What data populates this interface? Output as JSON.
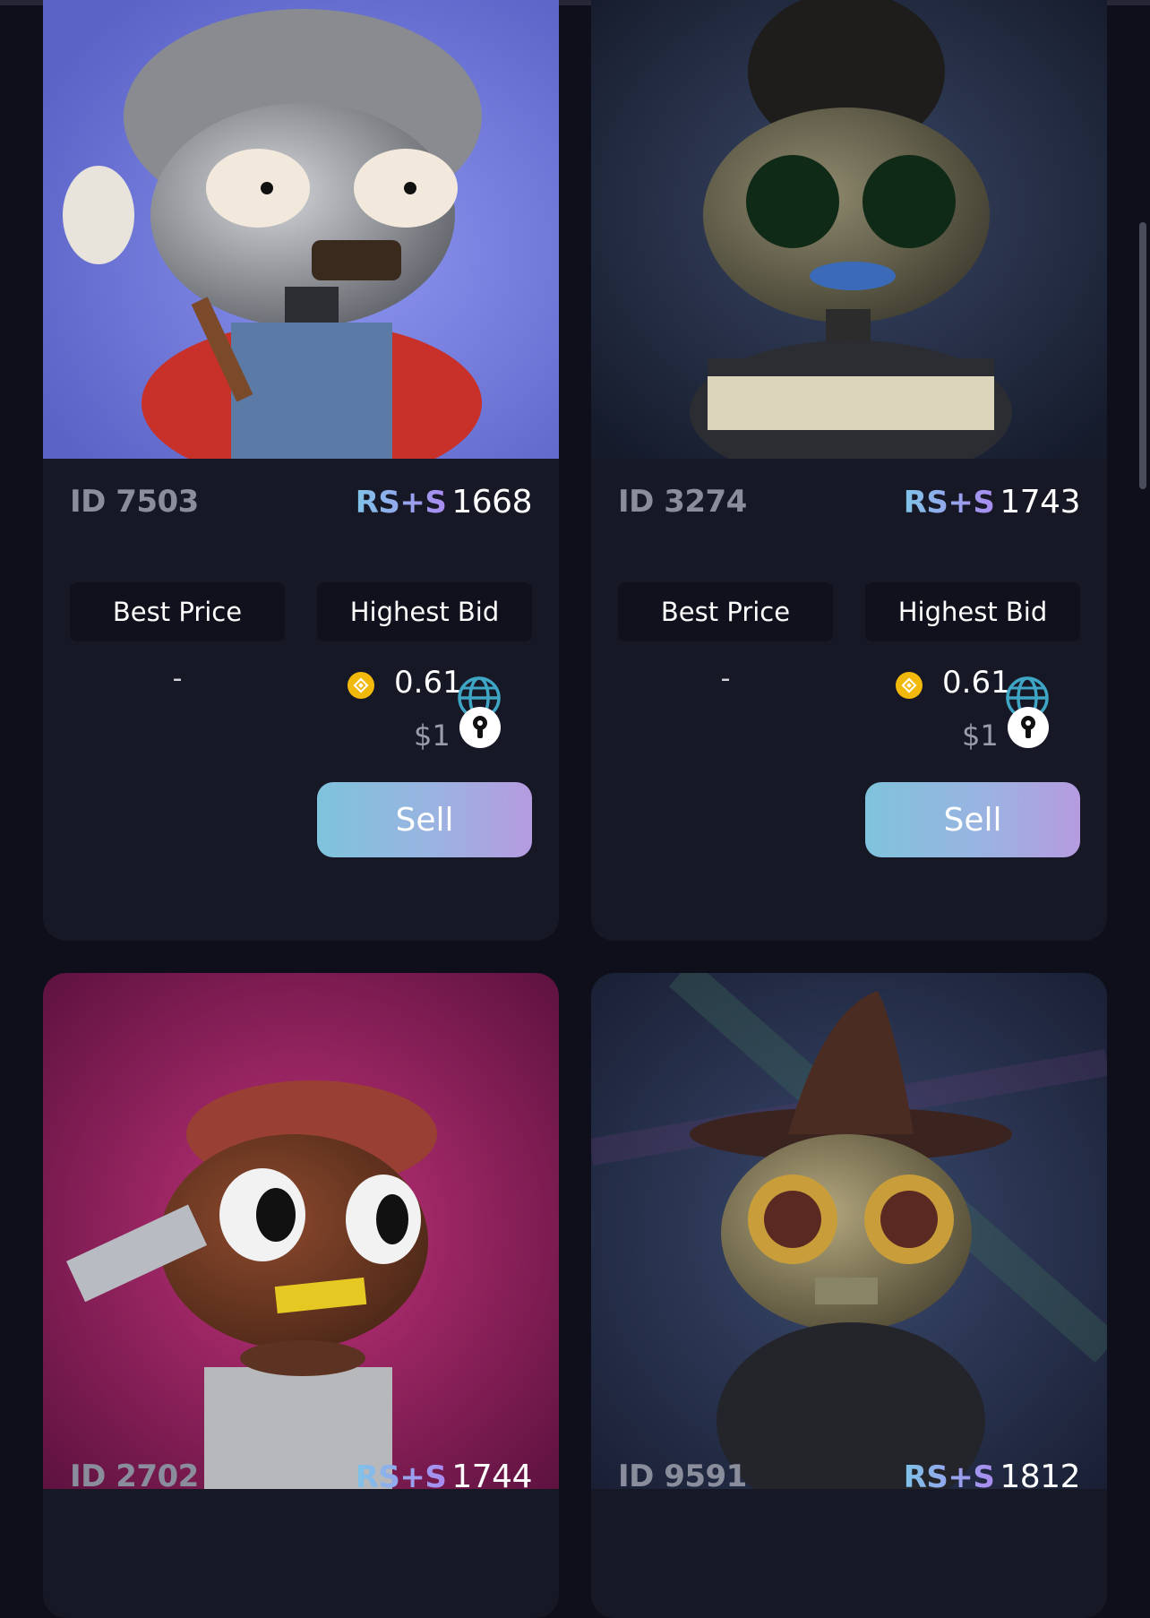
{
  "cards": [
    {
      "id_label": "ID 7503",
      "rs_label": "RS+S",
      "rs_value": "1668",
      "best_price_tab": "Best Price",
      "highest_bid_tab": "Highest Bid",
      "best_price_value": "-",
      "highest_bid_amount": "0.61",
      "highest_bid_usd": "$1",
      "sell_label": "Sell",
      "background": "#6a74d8"
    },
    {
      "id_label": "ID 3274",
      "rs_label": "RS+S",
      "rs_value": "1743",
      "best_price_tab": "Best Price",
      "highest_bid_tab": "Highest Bid",
      "best_price_value": "-",
      "highest_bid_amount": "0.61",
      "highest_bid_usd": "$1",
      "sell_label": "Sell",
      "background": "#2b3550"
    },
    {
      "id_label": "ID 2702",
      "rs_label": "RS+S",
      "rs_value": "1744",
      "background": "#a3205f"
    },
    {
      "id_label": "ID 9591",
      "rs_label": "RS+S",
      "rs_value": "1812",
      "background": "#27304a"
    }
  ],
  "colors": {
    "page_background": "#0e0f1a",
    "card_background": "#171826",
    "accent_gradient_start": "#7fc3dc",
    "accent_gradient_end": "#b69be0",
    "coin_color": "#f0b90b",
    "globe_color": "#3ea6c4"
  },
  "icons": {
    "coin": "bnb-coin-icon",
    "globe": "globe-icon",
    "lock": "lock-badge-icon"
  }
}
